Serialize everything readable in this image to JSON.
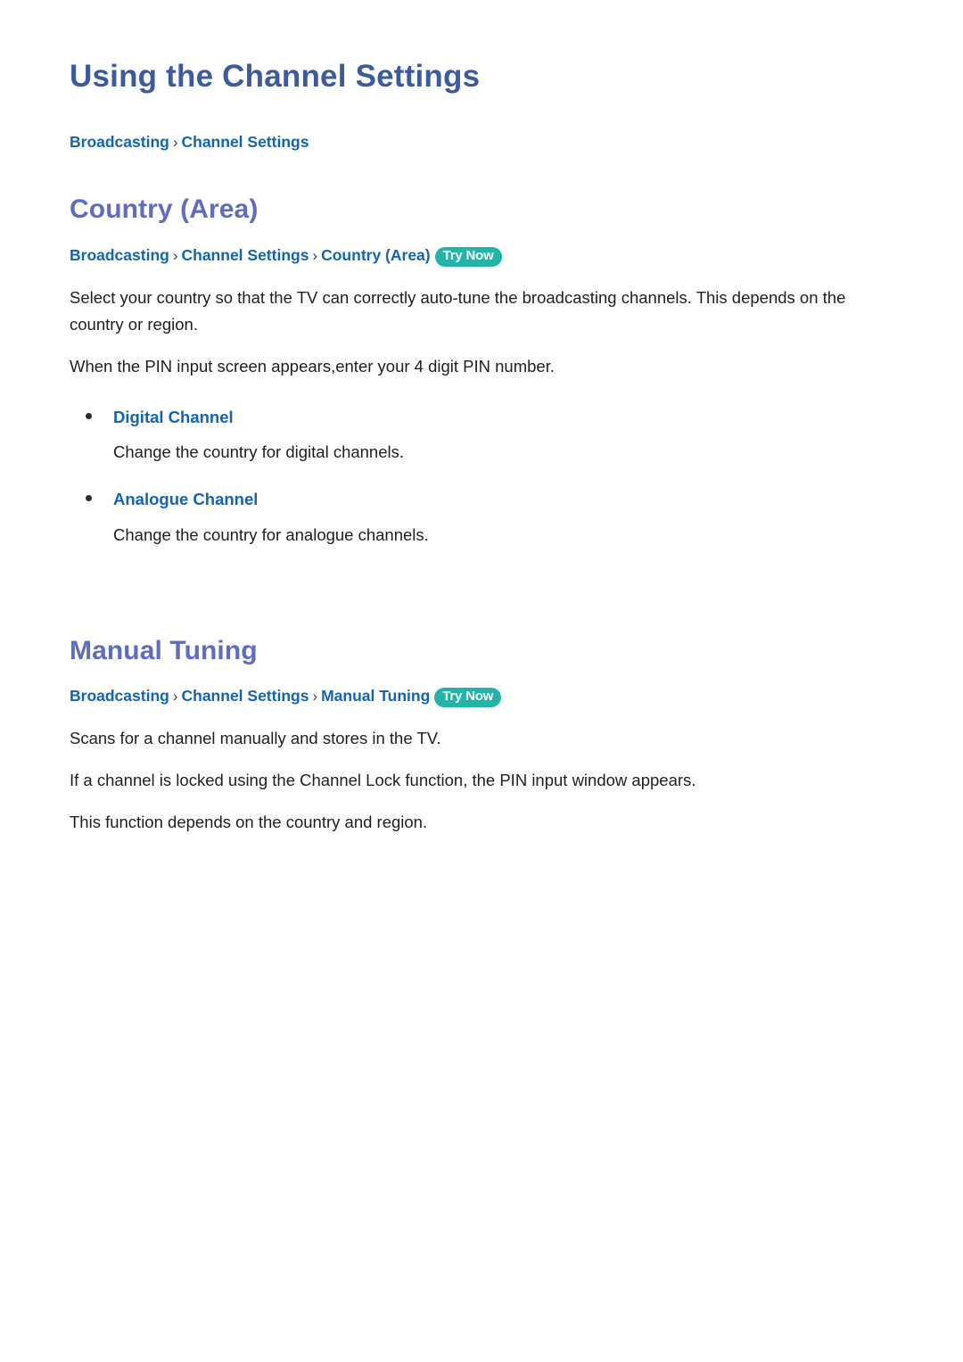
{
  "document": {
    "title": "Using the Channel Settings",
    "top_breadcrumb": {
      "crumbs": [
        "Broadcasting",
        "Channel Settings"
      ],
      "separator": "›"
    }
  },
  "sections": [
    {
      "heading": "Country (Area)",
      "breadcrumb": {
        "crumbs": [
          "Broadcasting",
          "Channel Settings",
          "Country (Area)"
        ],
        "separator": "›",
        "badge": "Try Now"
      },
      "paragraphs": [
        "Select your country so that the TV can correctly auto-tune the broadcasting channels. This depends on the country or region.",
        "When the PIN input screen appears,enter your 4 digit PIN number."
      ],
      "bullets": [
        {
          "label": "Digital Channel",
          "description": "Change the country for digital channels."
        },
        {
          "label": "Analogue Channel",
          "description": "Change the country for analogue channels."
        }
      ]
    },
    {
      "heading": "Manual Tuning",
      "breadcrumb": {
        "crumbs": [
          "Broadcasting",
          "Channel Settings",
          "Manual Tuning"
        ],
        "separator": "›",
        "badge": "Try Now"
      },
      "paragraphs": [
        "Scans for a channel manually and stores in the TV.",
        "If a channel is locked using the Channel Lock function, the PIN input window appears.",
        "This function depends on the country and region."
      ],
      "bullets": []
    }
  ],
  "colors": {
    "page_title": "#3c5a9e",
    "section_heading": "#5f6cc2",
    "breadcrumb_link": "#1265b5",
    "badge_background": "#20b5a7",
    "badge_text": "#ffffff",
    "body_text": "#1f1f1f"
  }
}
